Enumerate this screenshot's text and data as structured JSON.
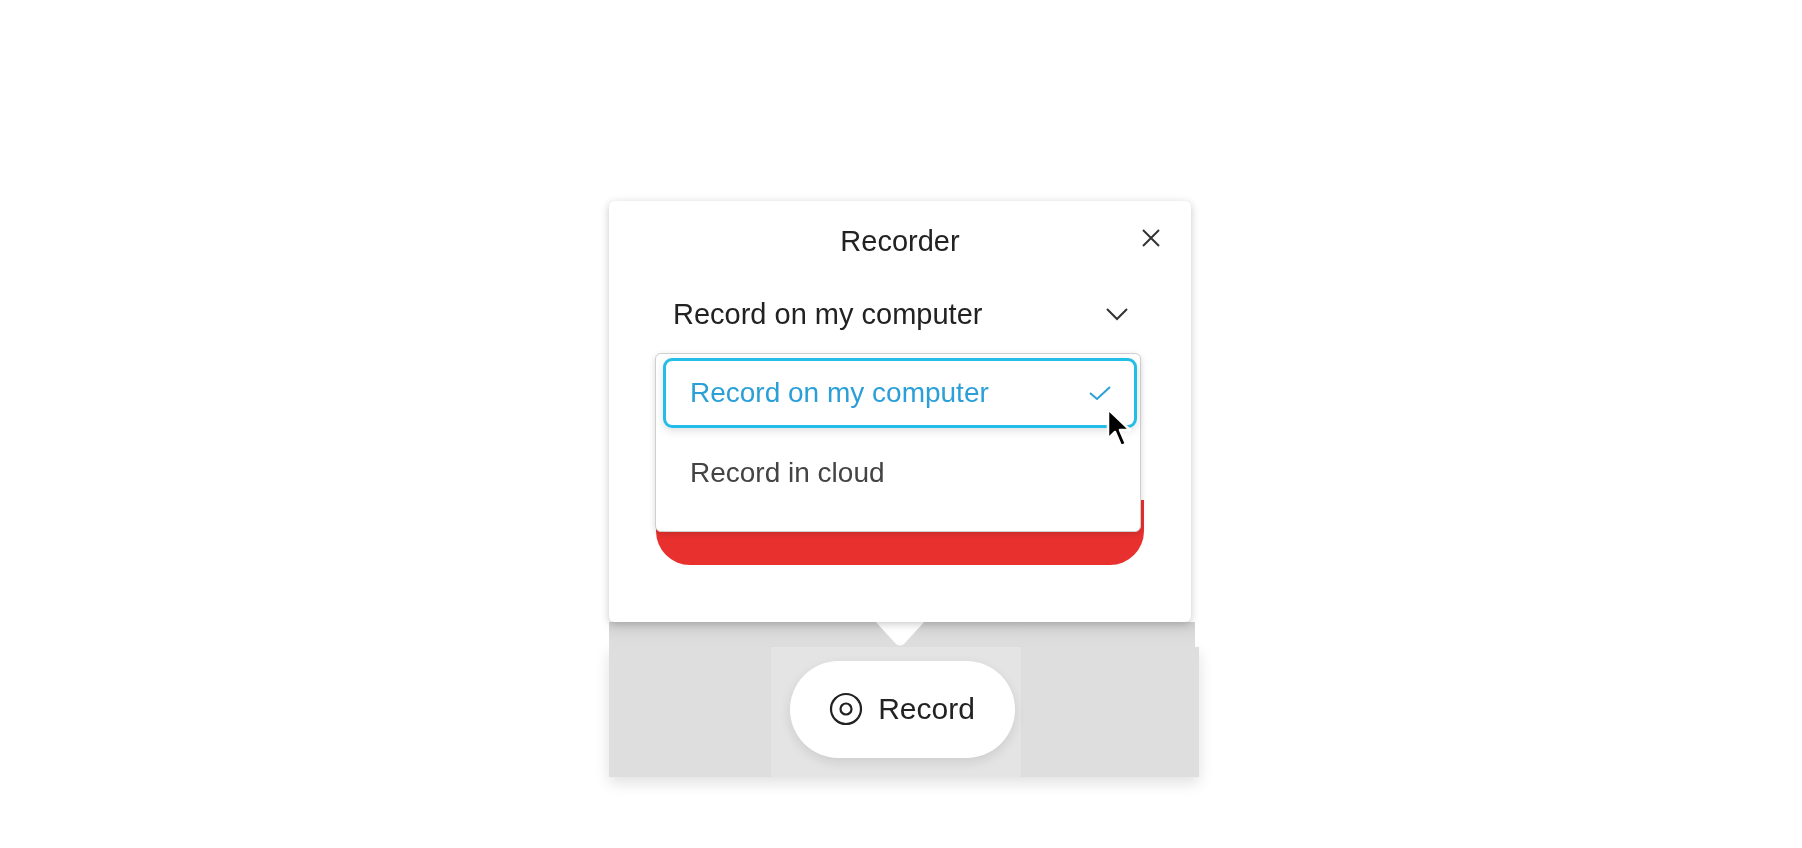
{
  "dialog": {
    "title": "Recorder"
  },
  "mode_select": {
    "value": "Record on my computer",
    "expanded": true
  },
  "dropdown": {
    "options": [
      {
        "label": "Record on my computer",
        "selected": true
      },
      {
        "label": "Record in cloud",
        "selected": false
      }
    ]
  },
  "toolbar": {
    "record_button": {
      "label": "Record"
    }
  }
}
